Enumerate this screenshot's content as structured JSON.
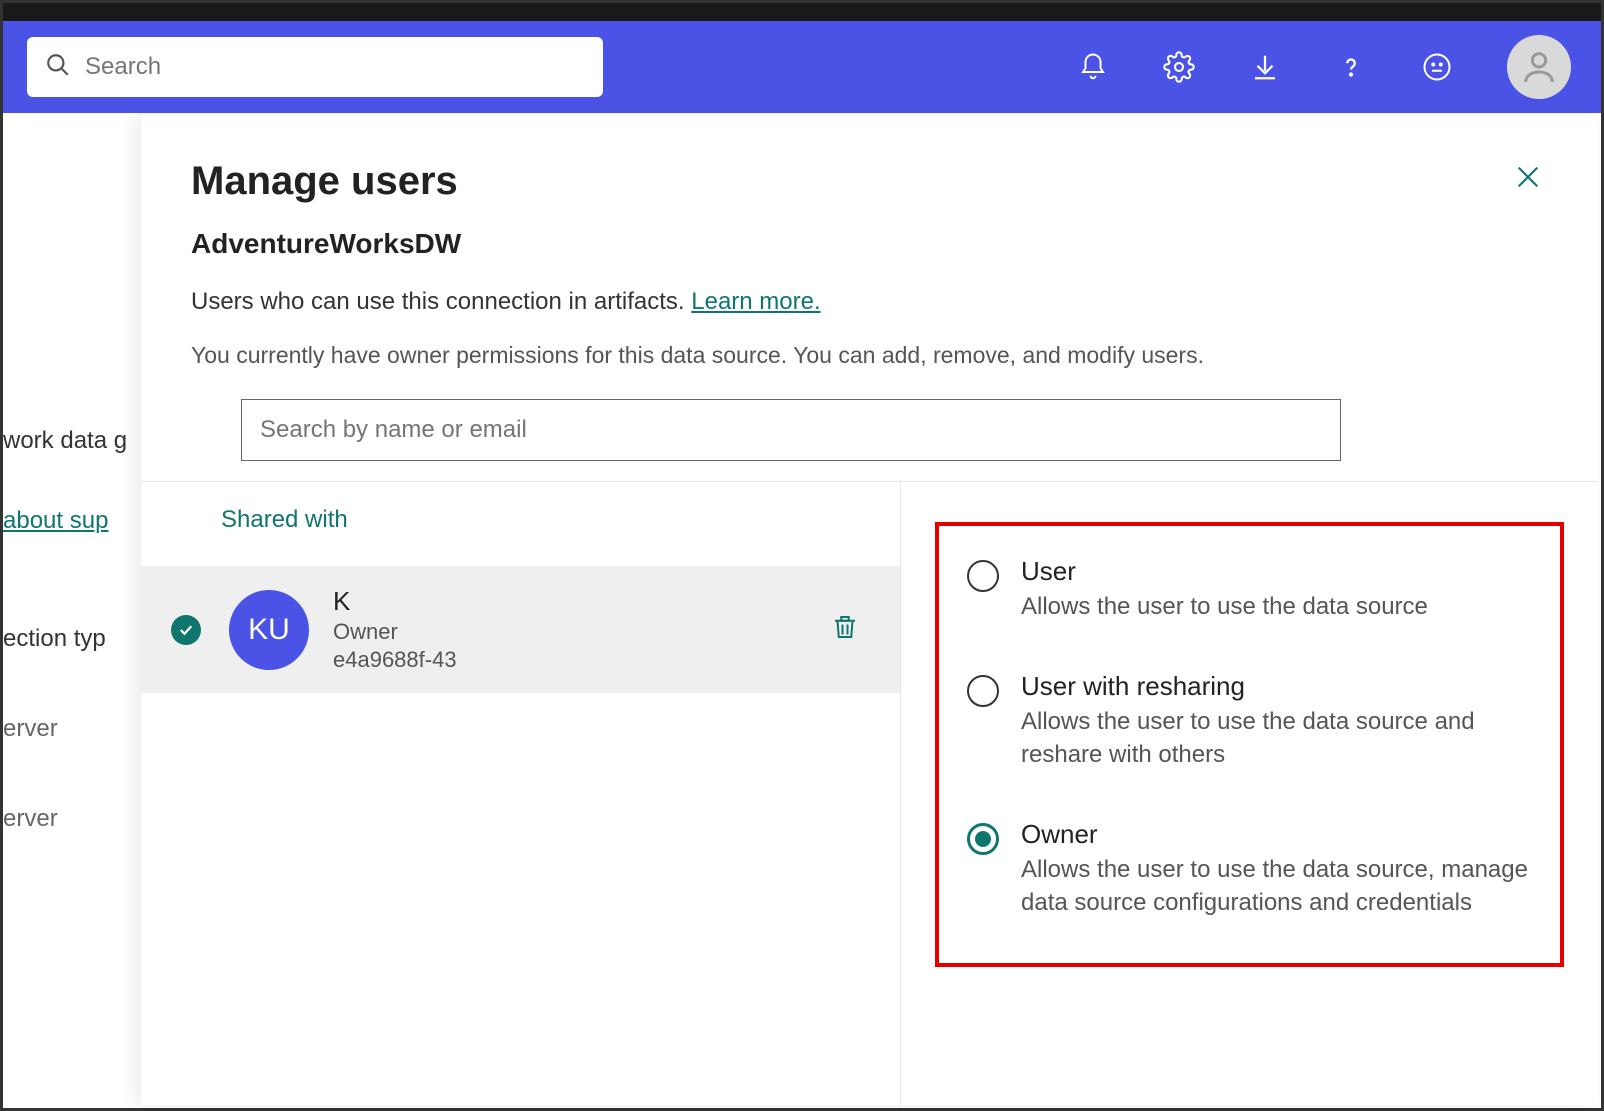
{
  "topbar": {
    "search_placeholder": "Search"
  },
  "background": {
    "line1": "work data g",
    "link": "about sup",
    "line2": "ection typ",
    "line3": "erver",
    "line4": "erver"
  },
  "panel": {
    "title": "Manage users",
    "subtitle": "AdventureWorksDW",
    "desc_prefix": "Users who can use this connection in artifacts. ",
    "learn_more": "Learn more.",
    "owner_note": "You currently have owner permissions for this data source. You can add, remove, and modify users.",
    "search_placeholder": "Search by name or email",
    "tab": "Shared with"
  },
  "user": {
    "initials": "KU",
    "name": "K",
    "role": "Owner",
    "id": "e4a9688f-43"
  },
  "roles": [
    {
      "label": "User",
      "desc": "Allows the user to use the data source",
      "checked": false
    },
    {
      "label": "User with resharing",
      "desc": "Allows the user to use the data source and reshare with others",
      "checked": false
    },
    {
      "label": "Owner",
      "desc": "Allows the user to use the data source, manage data source configurations and credentials",
      "checked": true
    }
  ]
}
